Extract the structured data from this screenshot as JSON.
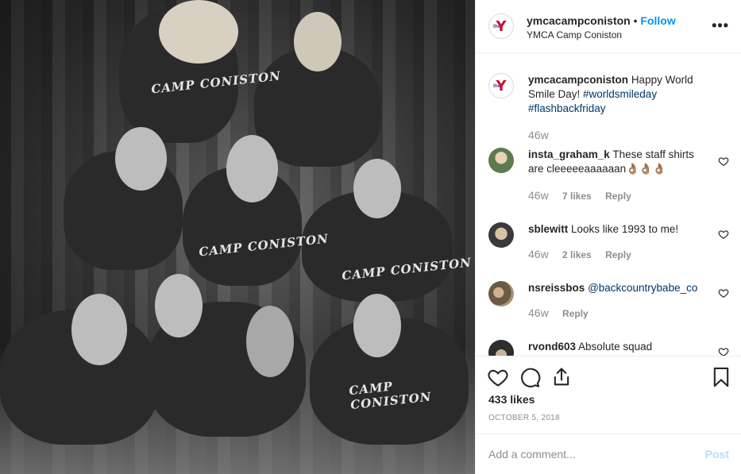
{
  "post": {
    "photo_alt": "",
    "shirt_text": "CAMP CONISTON"
  },
  "header": {
    "username": "ymcacampconiston",
    "separator": "•",
    "follow_label": "Follow",
    "location": "YMCA Camp Coniston",
    "more_icon": "more-horizontal-icon"
  },
  "caption": {
    "username": "ymcacampconiston",
    "text": "Happy World Smile Day!",
    "hashtag1": "#worldsmileday",
    "hashtag2": "#flashbackfriday",
    "time": "46w"
  },
  "comments": [
    {
      "username": "insta_graham_k",
      "text": "These staff shirts are cleeeeeaaaaaan👌🏽👌🏽👌🏽",
      "time": "46w",
      "likes": "7 likes",
      "reply": "Reply"
    },
    {
      "username": "sblewitt",
      "text": "Looks like 1993 to me!",
      "time": "46w",
      "likes": "2 likes",
      "reply": "Reply"
    },
    {
      "username": "nsreissbos",
      "mention": "@backcountrybabe_co",
      "time": "46w",
      "reply": "Reply"
    },
    {
      "username": "rvond603",
      "text": "Absolute squad"
    }
  ],
  "actions": {
    "like_icon": "heart-icon",
    "comment_icon": "comment-icon",
    "share_icon": "share-icon",
    "save_icon": "bookmark-icon",
    "likes": "433 likes",
    "date": "OCTOBER 5, 2018"
  },
  "add_comment": {
    "placeholder": "Add a comment...",
    "post_label": "Post"
  },
  "colors": {
    "accent": "#0095f6",
    "post_disabled": "#b2dffc",
    "ymca_red": "#c8102e",
    "ymca_purple": "#5b2c8e",
    "meta_gray": "#8e8e8e",
    "link": "#00376b"
  }
}
